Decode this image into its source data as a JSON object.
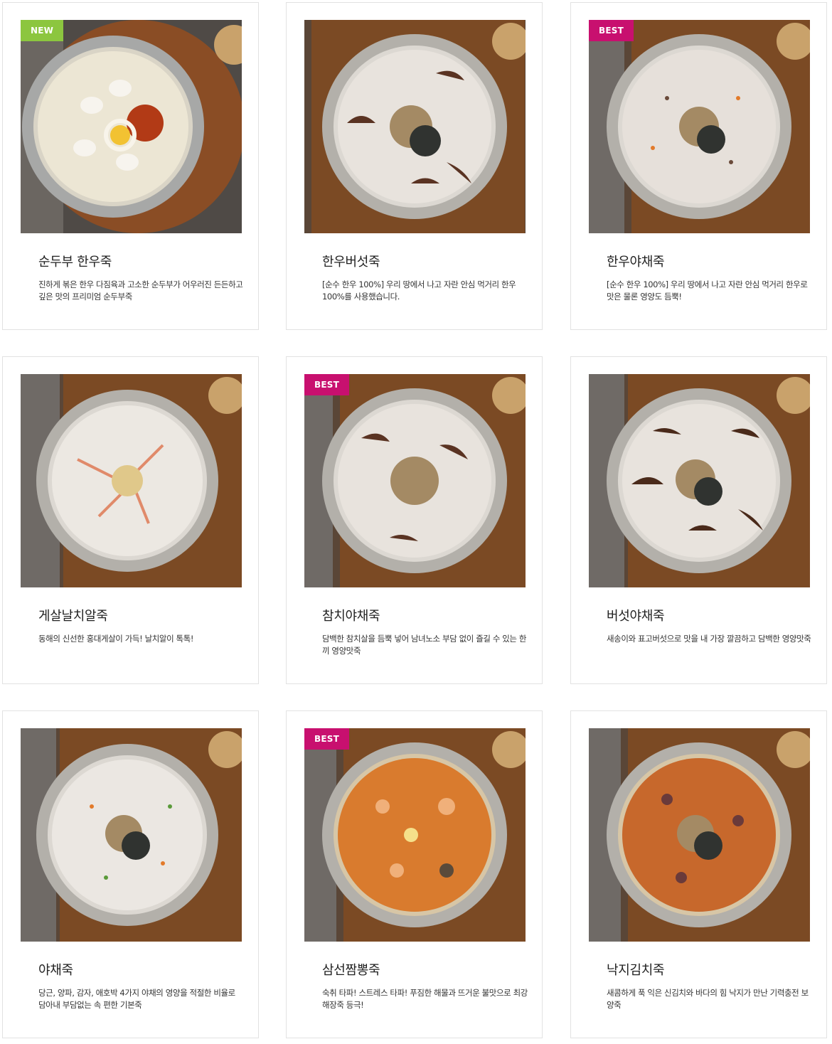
{
  "colors": {
    "new_badge": "#8cc63f",
    "best_badge": "#c8106f",
    "card_border": "#e2e2e2"
  },
  "products": [
    {
      "name": "순두부 한우죽",
      "badge": "NEW",
      "description": "진하게 볶은 한우 다짐육과 고소한 순두부가 어우러진 든든하고 깊은 맛의 프리미엄 순두부죽",
      "image": "porridge-dish-soft-tofu-beef"
    },
    {
      "name": "한우버섯죽",
      "badge": "",
      "description": "[순수 한우 100%] 우리 땅에서 나고 자란 안심 먹거리 한우 100%를 사용했습니다.",
      "image": "porridge-dish-beef-mushroom"
    },
    {
      "name": "한우야채죽",
      "badge": "BEST",
      "description": "[순수 한우 100%] 우리 땅에서 나고 자란 안심 먹거리 한우로 맛은 물론 영양도 듬뿍!",
      "image": "porridge-dish-beef-vegetable"
    },
    {
      "name": "게살날치알죽",
      "badge": "",
      "description": "동해의 신선한 홍대게살이 가득! 날치알이 톡톡!",
      "image": "porridge-dish-crab-roe"
    },
    {
      "name": "참치야채죽",
      "badge": "BEST",
      "description": "담백한 참치살을 듬뿍 넣어 남녀노소 부담 없이 즐길 수 있는 한 끼 영양맛죽",
      "image": "porridge-dish-tuna-vegetable"
    },
    {
      "name": "버섯야채죽",
      "badge": "",
      "description": "새송이와 표고버섯으로 맛을 내 가장 깔끔하고 담백한 영양맛죽",
      "image": "porridge-dish-mushroom-vegetable"
    },
    {
      "name": "야채죽",
      "badge": "",
      "description": "당근, 양파, 감자, 애호박 4가지 야채의 영양을 적절한 비율로 담아내 부담없는 속 편한 기본죽",
      "image": "porridge-dish-vegetable"
    },
    {
      "name": "삼선짬뽕죽",
      "badge": "BEST",
      "description": "숙취 타파! 스트레스 타파! 푸짐한 해물과 뜨거운 불맛으로 최강 해장죽 등극!",
      "image": "porridge-dish-seafood-jjamppong"
    },
    {
      "name": "낙지김치죽",
      "badge": "",
      "description": "새콤하게 푹 익은 신김치와 바다의 힘 낙지가 만난 기력충전 보양죽",
      "image": "porridge-dish-octopus-kimchi"
    }
  ]
}
